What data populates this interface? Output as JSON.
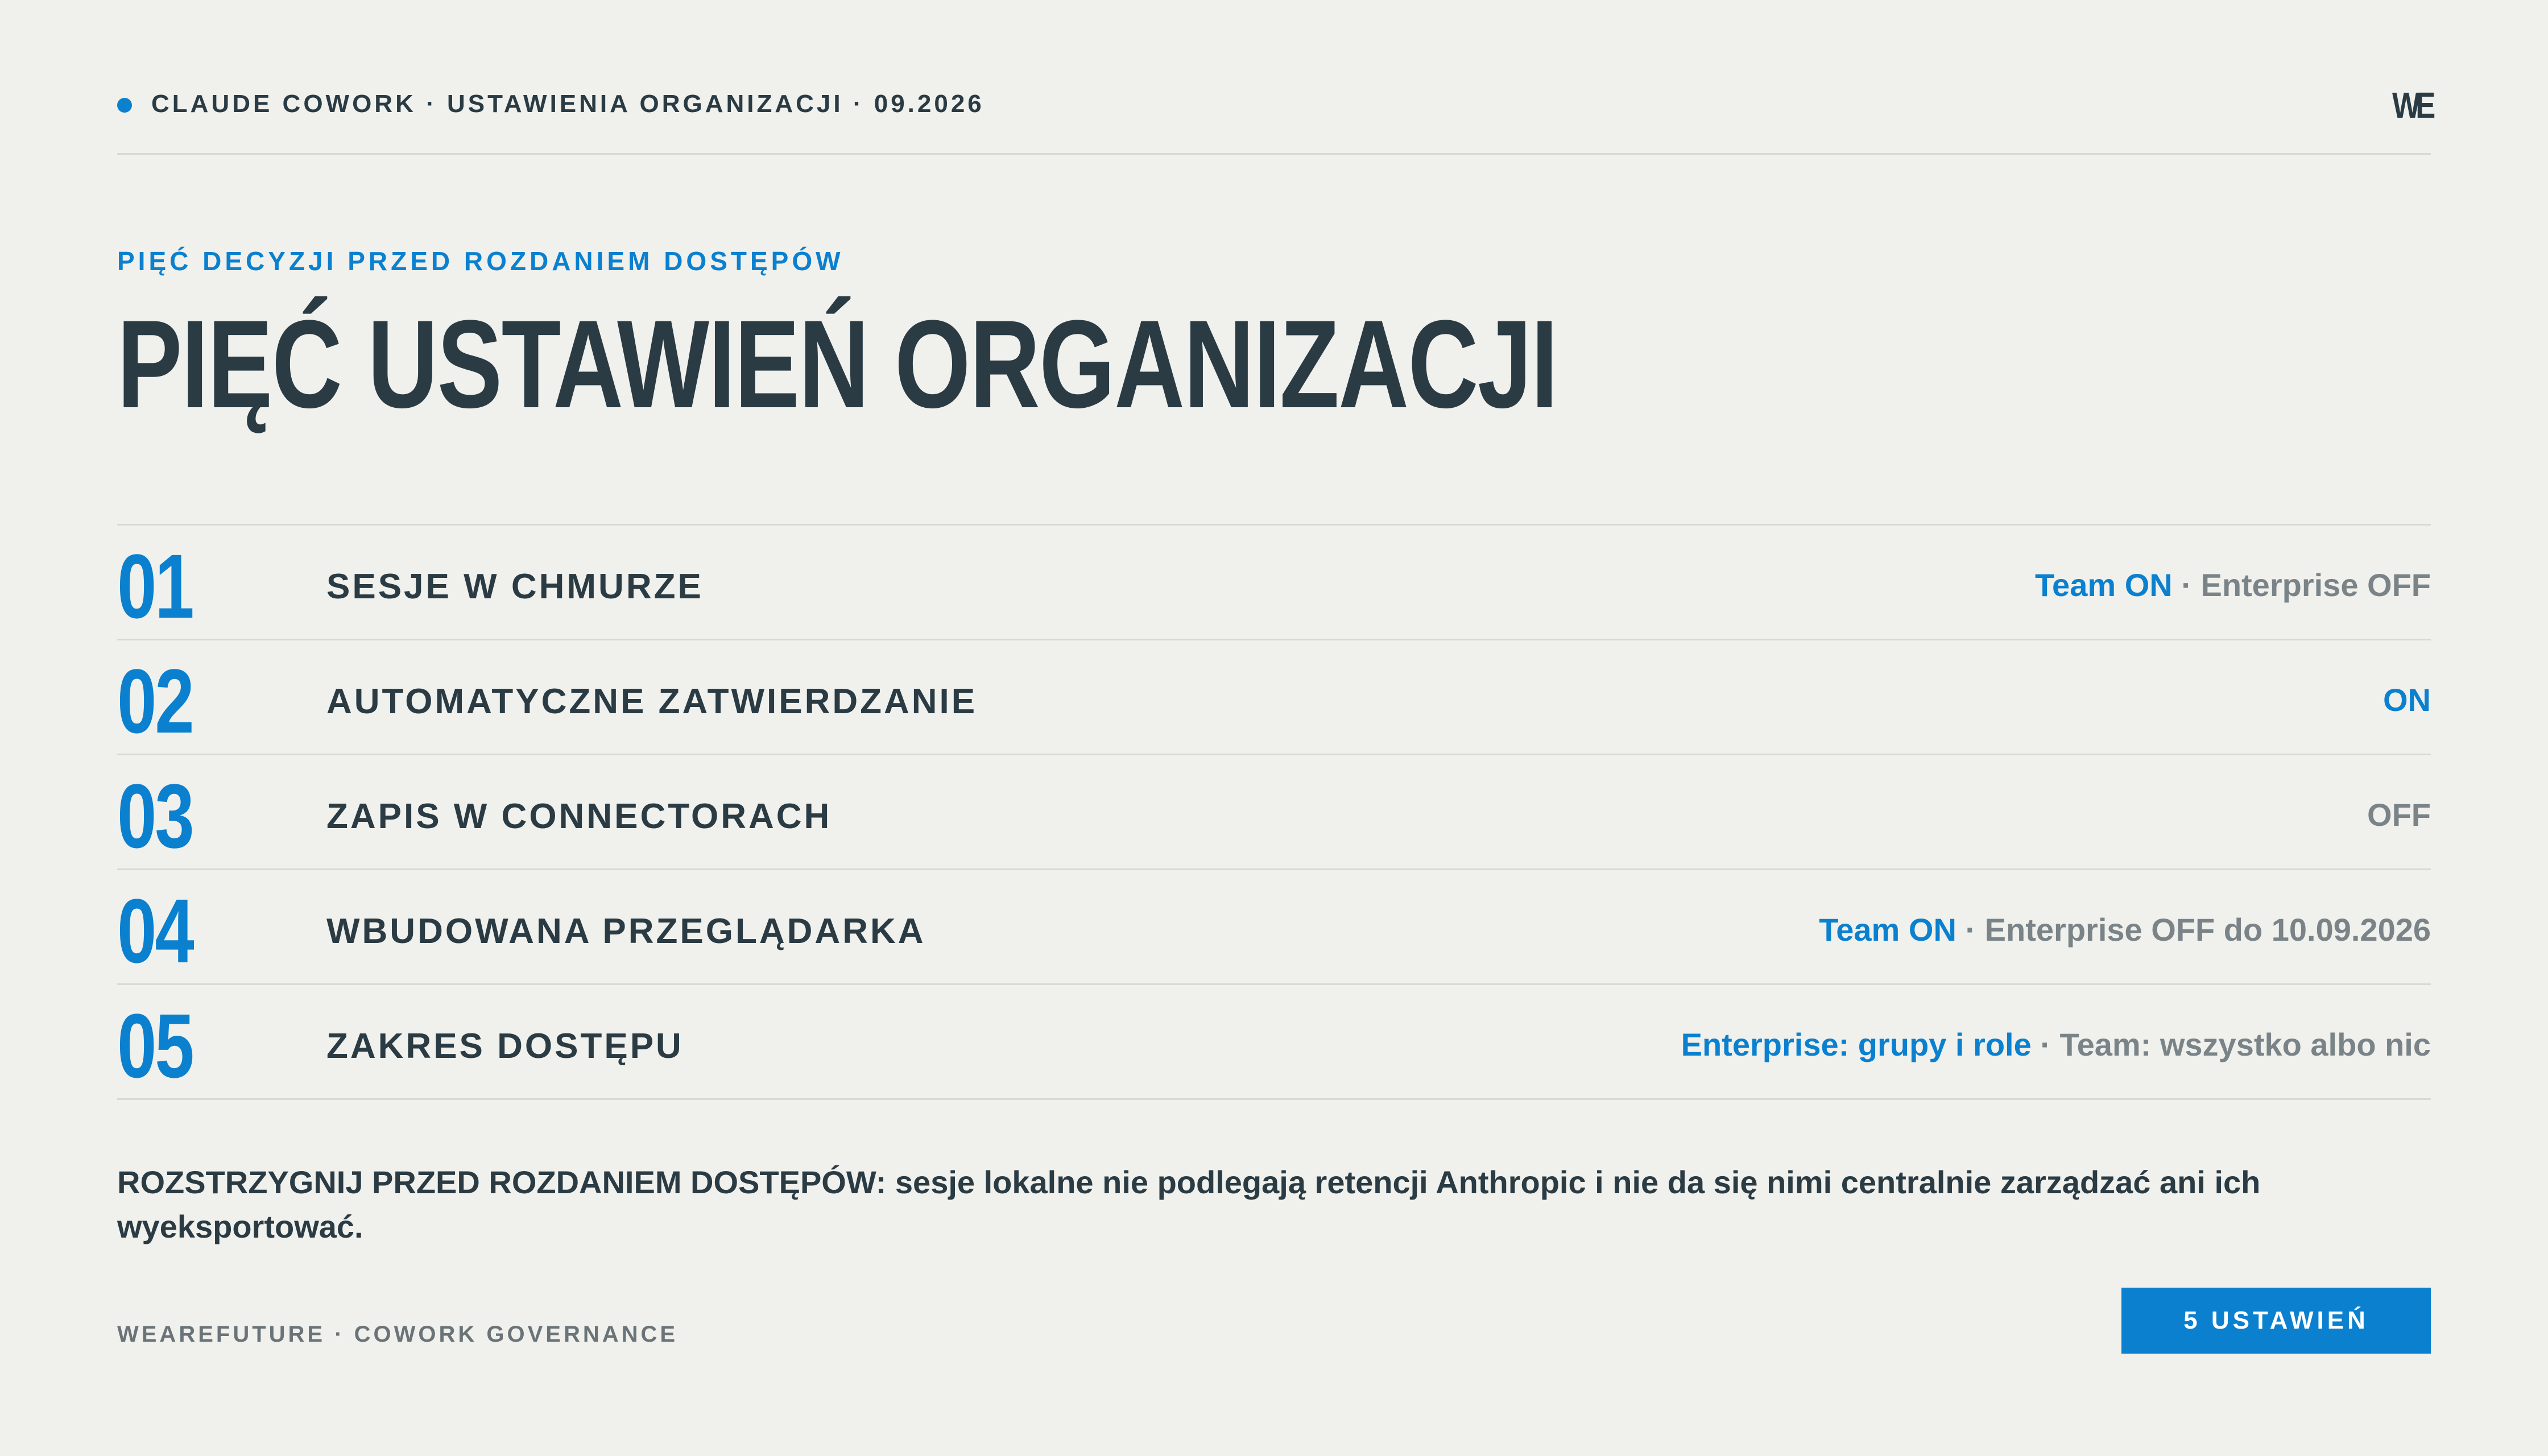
{
  "header": {
    "breadcrumb": "CLAUDE COWORK · USTAWIENIA ORGANIZACJI · 09.2026",
    "logo_text": "WE"
  },
  "eyebrow": "PIĘĆ DECYZJI PRZED ROZDANIEM DOSTĘPÓW",
  "title": "PIĘĆ USTAWIEŃ ORGANIZACJI",
  "settings": [
    {
      "number": "01",
      "label": "SESJE W CHMURZE",
      "status_primary": "Team ON",
      "separator": " · ",
      "status_secondary": "Enterprise OFF"
    },
    {
      "number": "02",
      "label": "AUTOMATYCZNE ZATWIERDZANIE",
      "status_primary": "ON",
      "separator": "",
      "status_secondary": ""
    },
    {
      "number": "03",
      "label": "ZAPIS W CONNECTORACH",
      "status_primary": "",
      "separator": "",
      "status_secondary": "OFF"
    },
    {
      "number": "04",
      "label": "WBUDOWANA PRZEGLĄDARKA",
      "status_primary": "Team ON",
      "separator": " · ",
      "status_secondary": "Enterprise OFF do 10.09.2026"
    },
    {
      "number": "05",
      "label": "ZAKRES DOSTĘPU",
      "status_primary": "Enterprise: grupy i role",
      "separator": " · ",
      "status_secondary": "Team: wszystko albo nic"
    }
  ],
  "note": "ROZSTRZYGNIJ PRZED ROZDANIEM DOSTĘPÓW: sesje lokalne nie podlegają retencji Anthropic i nie da się nimi centralnie zarządzać ani ich wyeksportować.",
  "footer": {
    "left": "WEAREFUTURE · COWORK GOVERNANCE",
    "button": "5 USTAWIEŃ"
  },
  "colors": {
    "accent": "#0a80cf",
    "text": "#2a3b44",
    "muted": "#7a8488",
    "background": "#f0f0ec"
  }
}
